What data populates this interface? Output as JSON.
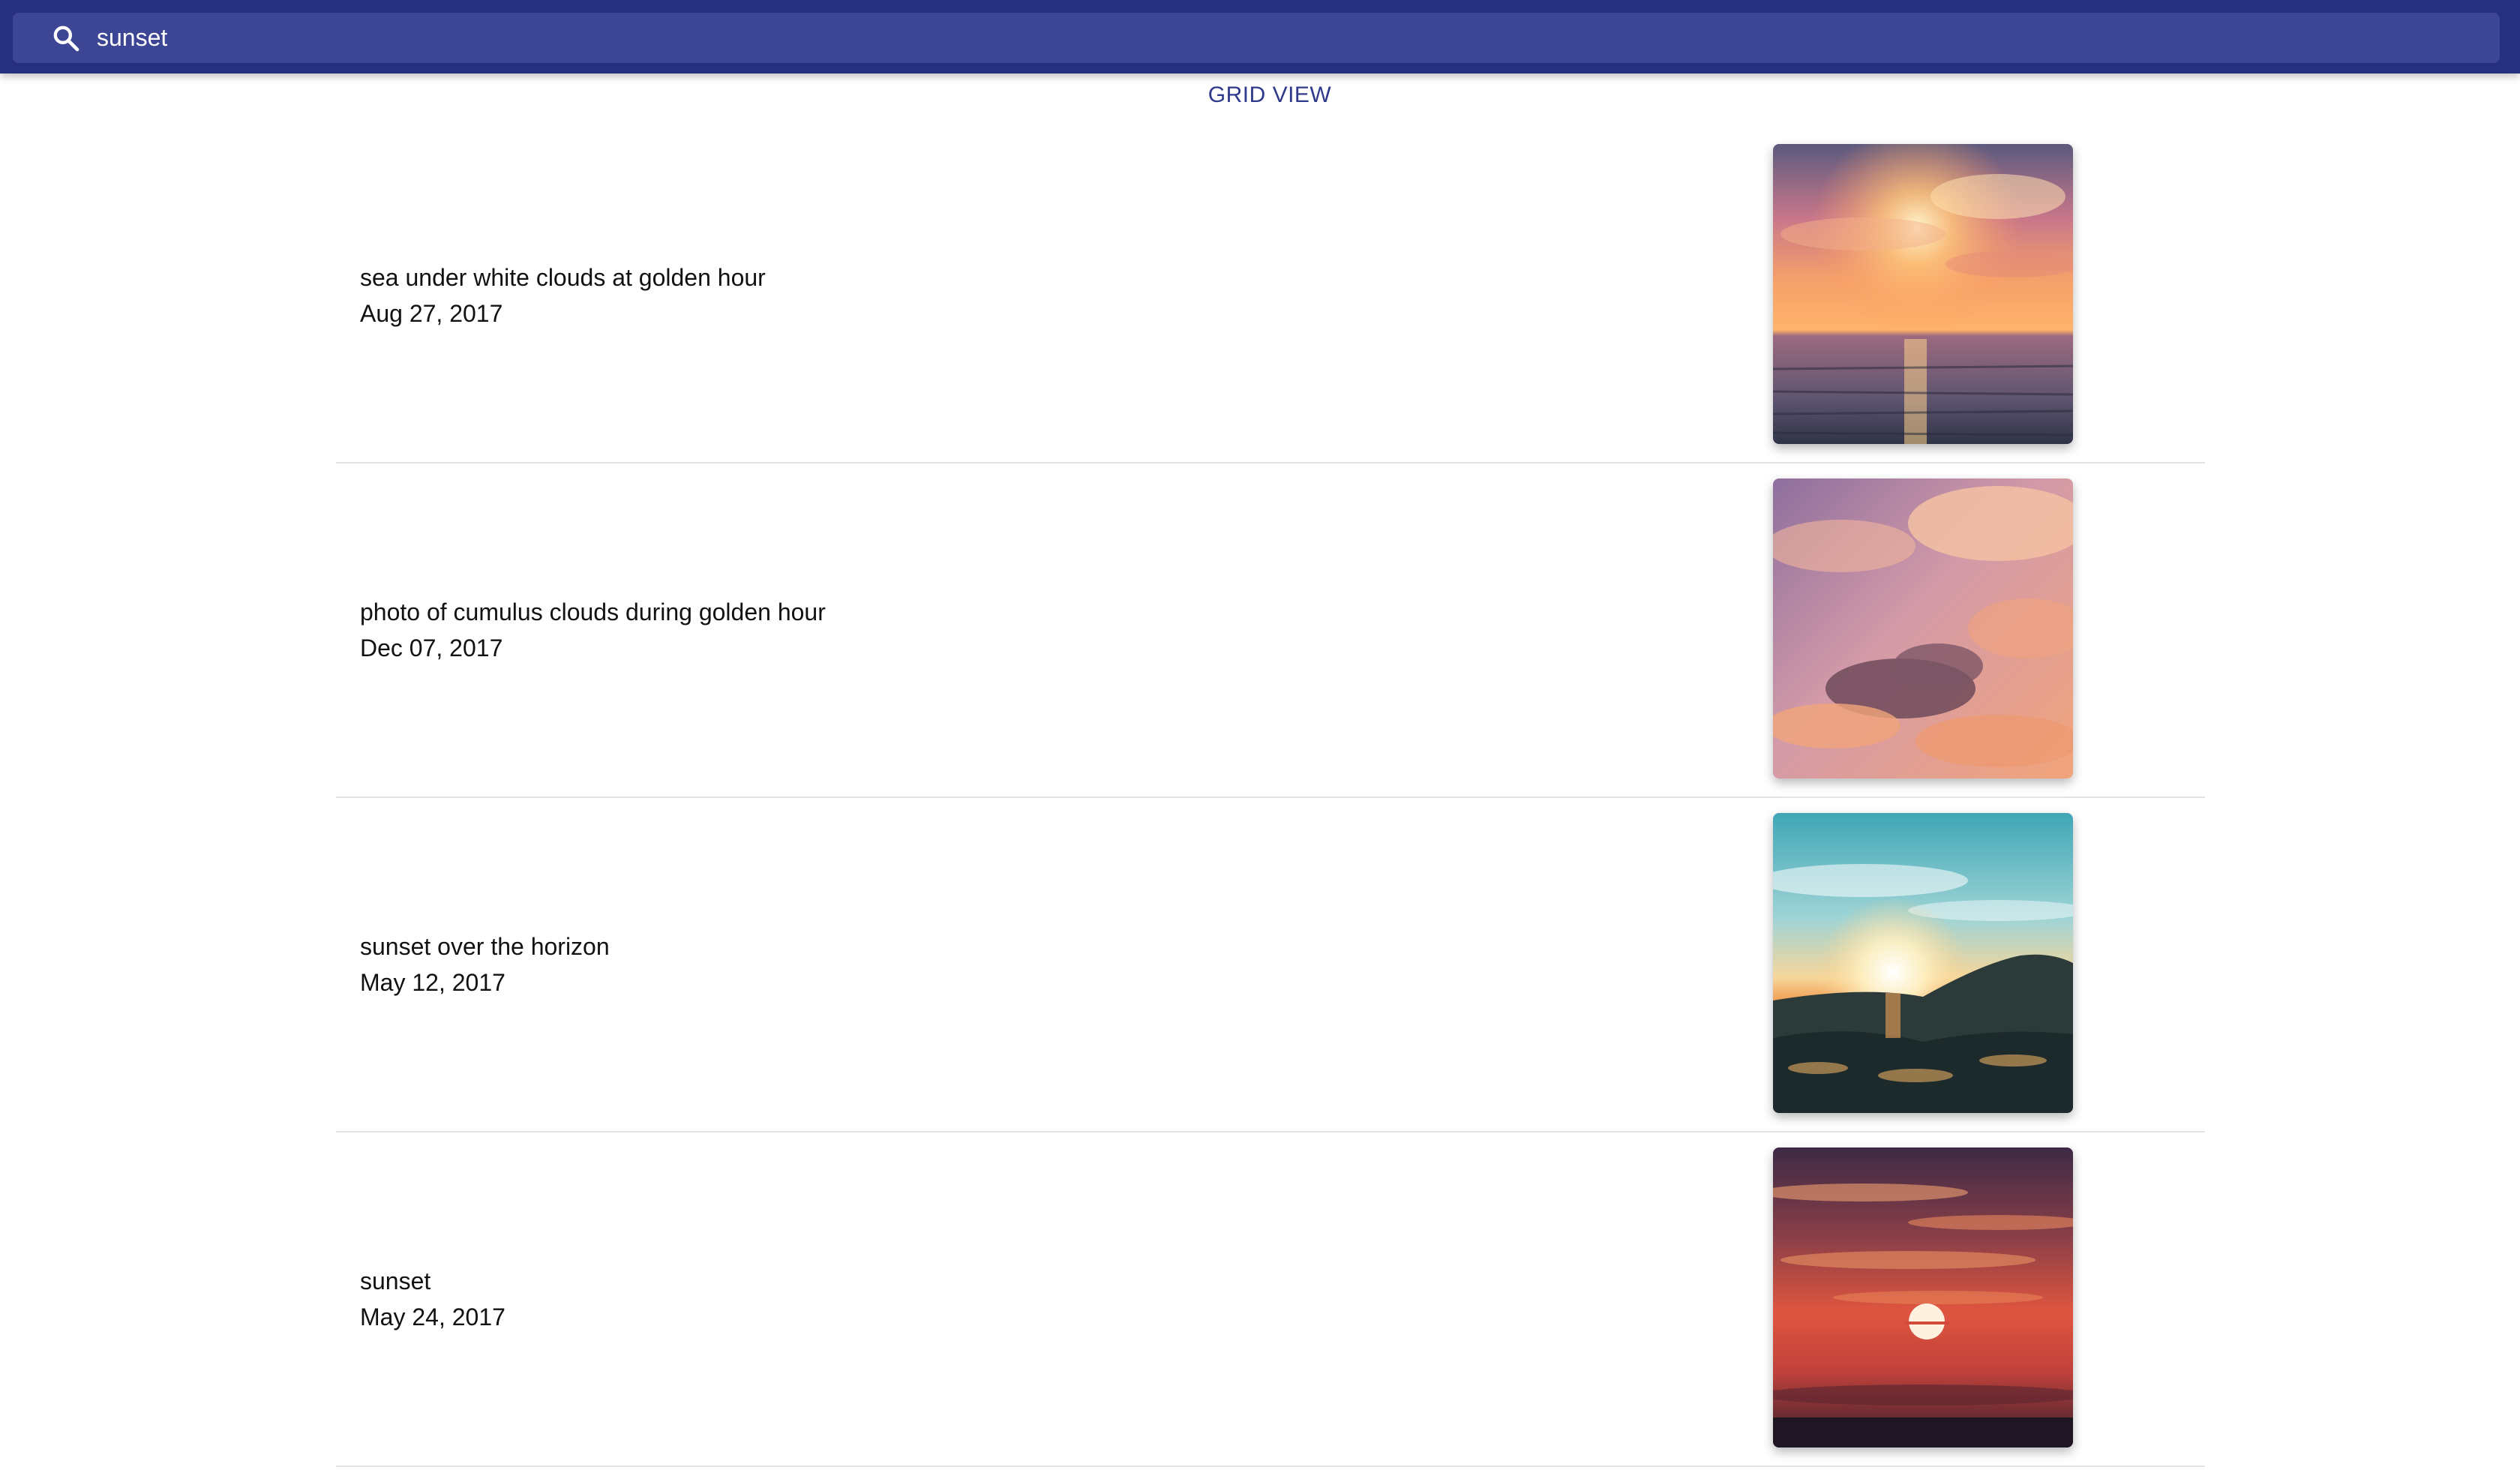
{
  "search": {
    "value": "sunset",
    "icon": "search-icon"
  },
  "view_toggle": {
    "label": "GRID VIEW"
  },
  "colors": {
    "app_bar": "#27307f",
    "search_box": "#3d4694",
    "accent_text": "#303a8c"
  },
  "results": [
    {
      "title": "sea under white clouds at golden hour",
      "date": "Aug 27, 2017"
    },
    {
      "title": "photo of cumulus clouds during golden hour",
      "date": "Dec 07, 2017"
    },
    {
      "title": "sunset over the horizon",
      "date": "May 12, 2017"
    },
    {
      "title": "sunset",
      "date": "May 24, 2017"
    }
  ]
}
